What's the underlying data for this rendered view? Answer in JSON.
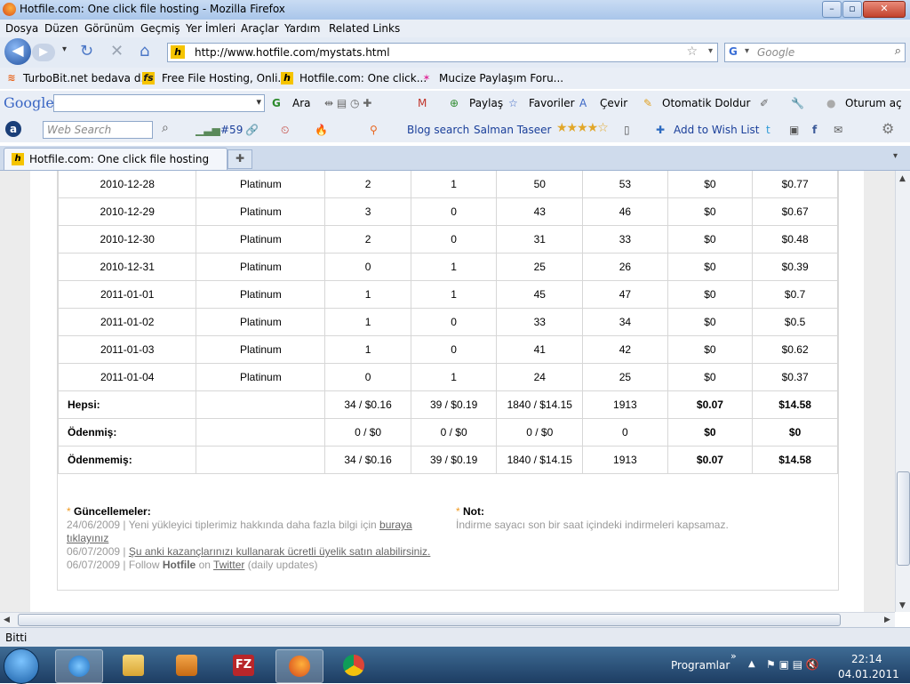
{
  "window": {
    "title": "Hotfile.com: One click file hosting - Mozilla Firefox"
  },
  "menu": [
    "Dosya",
    "Düzen",
    "Görünüm",
    "Geçmiş",
    "Yer İmleri",
    "Araçlar",
    "Yardım",
    "Related Links"
  ],
  "nav": {
    "url": "http://www.hotfile.com/mystats.html",
    "search_placeholder": "Google"
  },
  "bookmarks": [
    "TurboBit.net bedava d...",
    "Free File Hosting, Onli...",
    "Hotfile.com: One click...",
    "Mucize Paylaşım Foru..."
  ],
  "google_toolbar": {
    "logo": "Google",
    "search": "Ara",
    "share": "Paylaş",
    "favorites": "Favoriler",
    "translate": "Çevir",
    "autofill": "Otomatik Doldur",
    "signin": "Oturum aç"
  },
  "alexa_toolbar": {
    "search_placeholder": "Web Search",
    "rank": "#59",
    "blog_search": "Blog search",
    "user": "Salman Taseer",
    "wishlist": "Add to Wish List"
  },
  "tabs": [
    {
      "label": "Hotfile.com: One click file hosting"
    }
  ],
  "stats": {
    "rows": [
      [
        "2010-12-28",
        "Platinum",
        "2",
        "1",
        "50",
        "53",
        "$0",
        "$0.77"
      ],
      [
        "2010-12-29",
        "Platinum",
        "3",
        "0",
        "43",
        "46",
        "$0",
        "$0.67"
      ],
      [
        "2010-12-30",
        "Platinum",
        "2",
        "0",
        "31",
        "33",
        "$0",
        "$0.48"
      ],
      [
        "2010-12-31",
        "Platinum",
        "0",
        "1",
        "25",
        "26",
        "$0",
        "$0.39"
      ],
      [
        "2011-01-01",
        "Platinum",
        "1",
        "1",
        "45",
        "47",
        "$0",
        "$0.7"
      ],
      [
        "2011-01-02",
        "Platinum",
        "1",
        "0",
        "33",
        "34",
        "$0",
        "$0.5"
      ],
      [
        "2011-01-03",
        "Platinum",
        "1",
        "0",
        "41",
        "42",
        "$0",
        "$0.62"
      ],
      [
        "2011-01-04",
        "Platinum",
        "0",
        "1",
        "24",
        "25",
        "$0",
        "$0.37"
      ]
    ],
    "totals": [
      [
        "Hepsi:",
        "",
        "34 / $0.16",
        "39 / $0.19",
        "1840 / $14.15",
        "1913",
        "$0.07",
        "$14.58"
      ],
      [
        "Ödenmiş:",
        "",
        "0 / $0",
        "0 / $0",
        "0 / $0",
        "0",
        "$0",
        "$0"
      ],
      [
        "Ödenmemiş:",
        "",
        "34 / $0.16",
        "39 / $0.19",
        "1840 / $14.15",
        "1913",
        "$0.07",
        "$14.58"
      ]
    ]
  },
  "updates": {
    "title": "Güncellemeler:",
    "line1_date": "24/06/2009 | Yeni yükleyici tiplerimiz hakkında daha fazla bilgi için",
    "line1_link_a": "buraya",
    "line1_link_b": "tıklayınız",
    "line2_date": "06/07/2009 |",
    "line2_link": "Şu anki kazançlarınızı kullanarak ücretli üyelik satın alabilirsiniz.",
    "line3_prefix": "06/07/2009 | Follow",
    "line3_brand": "Hotfile",
    "line3_on": "on",
    "line3_link": "Twitter",
    "line3_suffix": "(daily updates)"
  },
  "note": {
    "title": "Not:",
    "text": "İndirme sayacı son bir saat içindeki indirmeleri kapsamaz."
  },
  "status": "Bitti",
  "taskbar": {
    "programs_label": "Programlar",
    "time": "22:14",
    "date": "04.01.2011"
  }
}
